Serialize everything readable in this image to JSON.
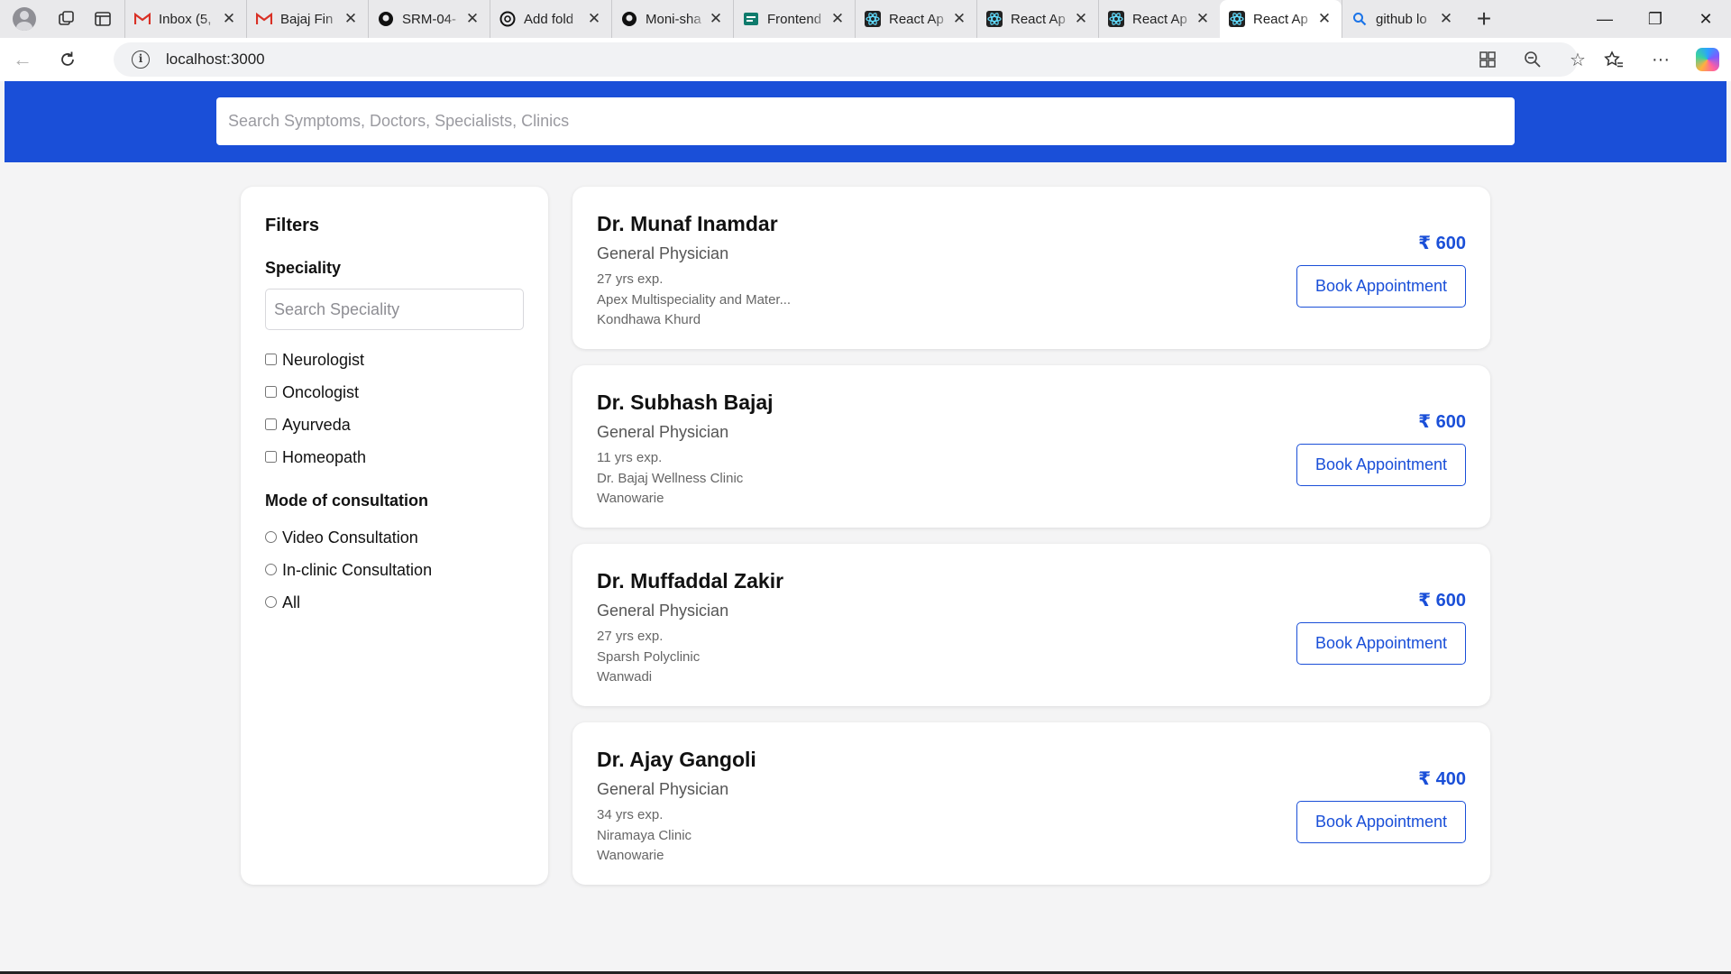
{
  "browser": {
    "tabs": [
      {
        "title": "Inbox (5,",
        "icon": "gmail-icon"
      },
      {
        "title": "Bajaj Fin",
        "icon": "gmail-icon"
      },
      {
        "title": "SRM-04-",
        "icon": "github-icon"
      },
      {
        "title": "Add fold",
        "icon": "openai-icon"
      },
      {
        "title": "Moni-sha",
        "icon": "github-icon"
      },
      {
        "title": "Frontend",
        "icon": "forms-icon"
      },
      {
        "title": "React Ap",
        "icon": "react-icon"
      },
      {
        "title": "React Ap",
        "icon": "react-icon"
      },
      {
        "title": "React Ap",
        "icon": "react-icon"
      },
      {
        "title": "React Ap",
        "icon": "react-icon",
        "active": true
      },
      {
        "title": "github lo",
        "icon": "search-icon"
      }
    ],
    "address": "localhost:3000"
  },
  "header": {
    "search_placeholder": "Search Symptoms, Doctors, Specialists, Clinics"
  },
  "filters": {
    "title": "Filters",
    "speciality_title": "Speciality",
    "speciality_search_placeholder": "Search Speciality",
    "specialities": [
      "Neurologist",
      "Oncologist",
      "Ayurveda",
      "Homeopath"
    ],
    "mode_title": "Mode of consultation",
    "modes": [
      "Video Consultation",
      "In-clinic Consultation",
      "All"
    ]
  },
  "doctors": [
    {
      "name": "Dr. Munaf Inamdar",
      "speciality": "General Physician",
      "experience": "27 yrs exp.",
      "clinic": "Apex Multispeciality and Mater...",
      "locality": "Kondhawa Khurd",
      "fee": "₹ 600",
      "action": "Book Appointment"
    },
    {
      "name": "Dr. Subhash Bajaj",
      "speciality": "General Physician",
      "experience": "11 yrs exp.",
      "clinic": "Dr. Bajaj Wellness Clinic",
      "locality": "Wanowarie",
      "fee": "₹ 600",
      "action": "Book Appointment"
    },
    {
      "name": "Dr. Muffaddal Zakir",
      "speciality": "General Physician",
      "experience": "27 yrs exp.",
      "clinic": "Sparsh Polyclinic",
      "locality": "Wanwadi",
      "fee": "₹ 600",
      "action": "Book Appointment"
    },
    {
      "name": "Dr. Ajay Gangoli",
      "speciality": "General Physician",
      "experience": "34 yrs exp.",
      "clinic": "Niramaya Clinic",
      "locality": "Wanowarie",
      "fee": "₹ 400",
      "action": "Book Appointment"
    }
  ],
  "colors": {
    "brand": "#1a4fd8",
    "background": "#f4f4f5"
  }
}
